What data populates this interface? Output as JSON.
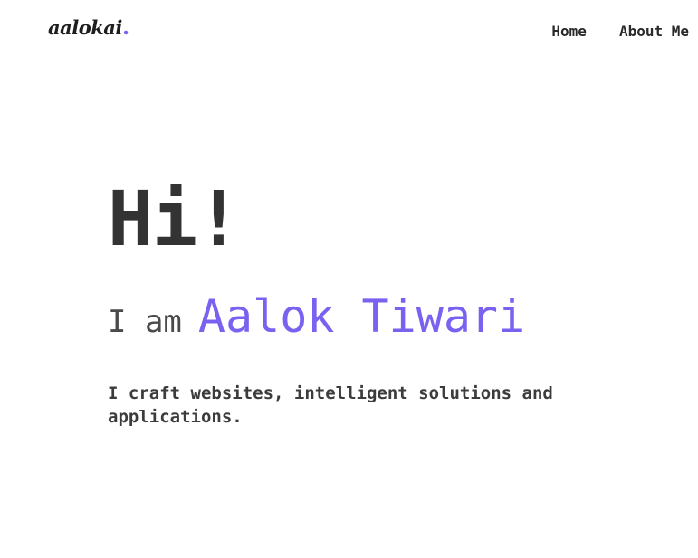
{
  "header": {
    "logo_text": "aalokai",
    "logo_dot": ".",
    "nav": [
      {
        "label": "Home"
      },
      {
        "label": "About Me"
      }
    ]
  },
  "hero": {
    "greeting": "Hi!",
    "intro_prefix": "I am",
    "name": "Aalok Tiwari",
    "tagline": "I craft websites, intelligent solutions and applications."
  },
  "colors": {
    "accent": "#7b61f0",
    "text": "#333333",
    "background": "#ffffff"
  }
}
